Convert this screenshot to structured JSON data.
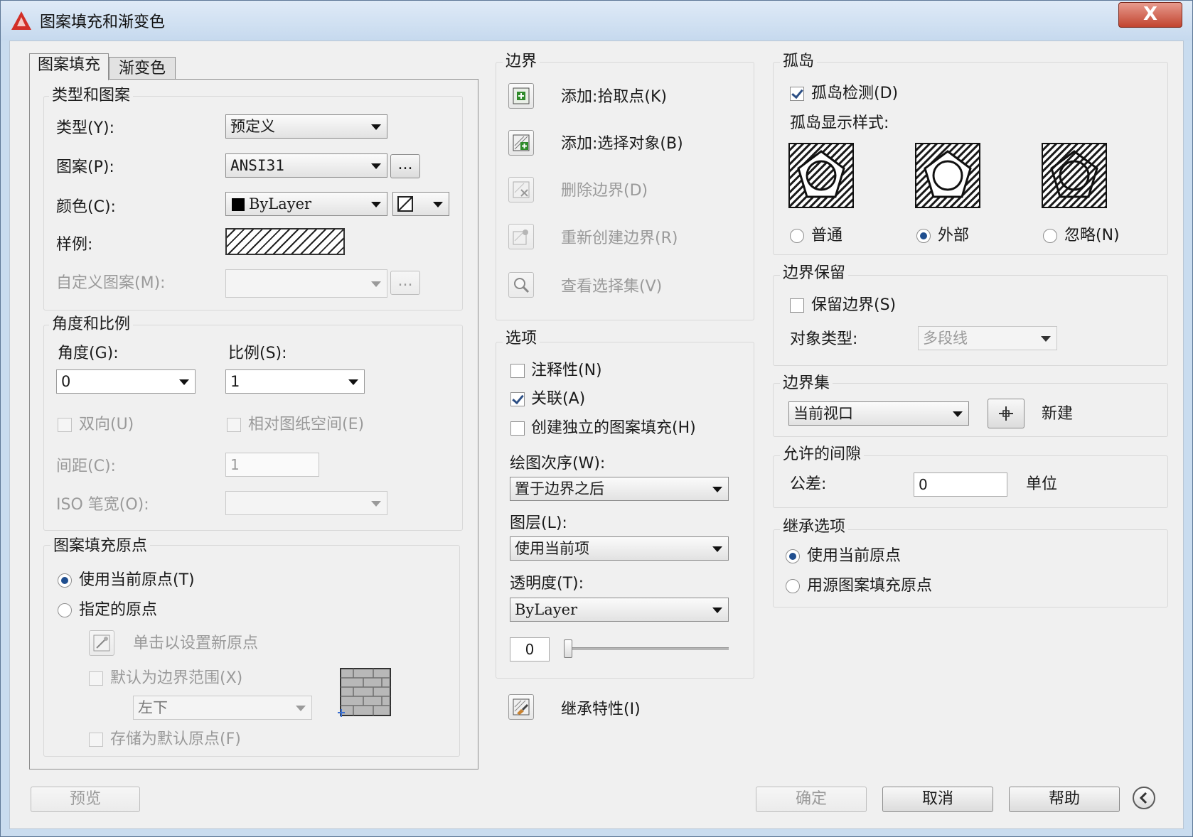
{
  "window": {
    "title": "图案填充和渐变色",
    "close_label": "X"
  },
  "tabs": [
    {
      "label": "图案填充",
      "active": true
    },
    {
      "label": "渐变色",
      "active": false
    }
  ],
  "type_pattern": {
    "group_title": "类型和图案",
    "type_label": "类型(Y):",
    "type_value": "预定义",
    "pattern_label": "图案(P):",
    "pattern_value": "ANSI31",
    "browse_label": "...",
    "color_label": "颜色(C):",
    "color_value": "ByLayer",
    "color_swatch": "#000000",
    "sample_label": "样例:",
    "custom_label": "自定义图案(M):",
    "custom_value": "",
    "custom_browse": "..."
  },
  "angle_scale": {
    "group_title": "角度和比例",
    "angle_label": "角度(G):",
    "angle_value": "0",
    "scale_label": "比例(S):",
    "scale_value": "1",
    "double_label": "双向(U)",
    "relative_label": "相对图纸空间(E)",
    "spacing_label": "间距(C):",
    "spacing_value": "1",
    "iso_label": "ISO 笔宽(O):",
    "iso_value": ""
  },
  "origin": {
    "group_title": "图案填充原点",
    "use_current": "使用当前原点(T)",
    "specified": "指定的原点",
    "click_set": "单击以设置新原点",
    "default_extents": "默认为边界范围(X)",
    "extents_value": "左下",
    "store_default": "存储为默认原点(F)"
  },
  "boundaries": {
    "group_title": "边界",
    "add_pick": "添加:拾取点(K)",
    "add_select": "添加:选择对象(B)",
    "remove": "删除边界(D)",
    "recreate": "重新创建边界(R)",
    "view": "查看选择集(V)"
  },
  "options": {
    "group_title": "选项",
    "annotative": "注释性(N)",
    "associative": "关联(A)",
    "separate": "创建独立的图案填充(H)",
    "draw_order_label": "绘图次序(W):",
    "draw_order_value": "置于边界之后",
    "layer_label": "图层(L):",
    "layer_value": "使用当前项",
    "transparency_label": "透明度(T):",
    "transparency_value": "ByLayer",
    "transparency_number": "0",
    "transparency_level": 0
  },
  "inherit": {
    "label": "继承特性(I)"
  },
  "islands": {
    "group_title": "孤岛",
    "detect": "孤岛检测(D)",
    "display_style": "孤岛显示样式:",
    "normal": "普通",
    "outer": "外部",
    "ignore": "忽略(N)",
    "selected": "outer"
  },
  "retain": {
    "group_title": "边界保留",
    "retain_label": "保留边界(S)",
    "object_type_label": "对象类型:",
    "object_type_value": "多段线"
  },
  "boundary_set": {
    "group_title": "边界集",
    "value": "当前视口",
    "new_label": "新建"
  },
  "gap": {
    "group_title": "允许的间隙",
    "tolerance_label": "公差:",
    "tolerance_value": "0",
    "unit_label": "单位"
  },
  "inherit_options": {
    "group_title": "继承选项",
    "use_current": "使用当前原点",
    "use_source": "用源图案填充原点"
  },
  "footer": {
    "preview": "预览",
    "ok": "确定",
    "cancel": "取消",
    "help": "帮助"
  }
}
